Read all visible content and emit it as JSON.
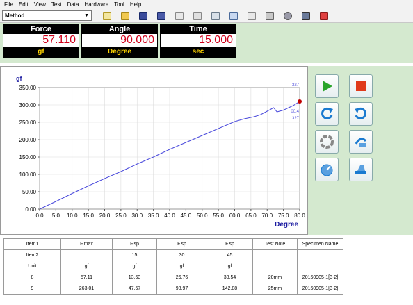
{
  "menu": [
    "File",
    "Edit",
    "View",
    "Test",
    "Data",
    "Hardware",
    "Tool",
    "Help"
  ],
  "toolbar": {
    "method_label": "Method",
    "icons": [
      "new-doc-icon",
      "open-folder-icon",
      "save-icon",
      "save-as-icon",
      "document-icon",
      "document-copy-icon",
      "settings-icon",
      "window-icon",
      "report-icon",
      "print-icon",
      "link-icon",
      "edit-icon",
      "exit-icon"
    ]
  },
  "readouts": [
    {
      "label": "Force",
      "value": "57.110",
      "unit": "gf"
    },
    {
      "label": "Angle",
      "value": "90.000",
      "unit": "Degree"
    },
    {
      "label": "Time",
      "value": "15.000",
      "unit": "sec"
    }
  ],
  "chart_data": {
    "type": "line",
    "ylabel": "gf",
    "xlabel": "Degree",
    "xlim": [
      0,
      80
    ],
    "ylim": [
      0,
      350
    ],
    "x_ticks": [
      "0.0",
      "5.0",
      "10.0",
      "15.0",
      "20.0",
      "25.0",
      "30.0",
      "35.0",
      "40.0",
      "45.0",
      "50.0",
      "55.0",
      "60.0",
      "65.0",
      "70.0",
      "75.0",
      "80.0"
    ],
    "y_ticks": [
      "0.00",
      "50.00",
      "100.00",
      "150.00",
      "200.00",
      "250.00",
      "300.00",
      "350.00"
    ],
    "series_color": "#4a4adc",
    "x": [
      0,
      5,
      10,
      15,
      20,
      25,
      30,
      35,
      40,
      45,
      50,
      55,
      60,
      63,
      66,
      68,
      70,
      72,
      73,
      75,
      78,
      80
    ],
    "y": [
      0,
      22,
      45,
      67,
      88,
      108,
      130,
      150,
      172,
      192,
      212,
      232,
      252,
      260,
      266,
      272,
      282,
      292,
      280,
      285,
      298,
      310
    ],
    "end_marker_labels": [
      "327",
      "00.4",
      "327"
    ],
    "end_marker_color": "#c00000"
  },
  "controls": [
    {
      "name": "start-icon",
      "color": "#2aa52a"
    },
    {
      "name": "stop-icon",
      "color": "#e03a1a"
    },
    {
      "name": "return-icon",
      "color": "#1a7ad0"
    },
    {
      "name": "undo-icon",
      "color": "#1a7ad0"
    },
    {
      "name": "reset-icon",
      "color": "#888888"
    },
    {
      "name": "calibrate-icon",
      "color": "#1a7ad0"
    },
    {
      "name": "speed-icon",
      "color": "#1a7ad0"
    },
    {
      "name": "fixture-icon",
      "color": "#1a7ad0"
    }
  ],
  "table": {
    "rows": [
      [
        "Item1",
        "F.max",
        "F.sp",
        "F.sp",
        "F.sp",
        "Test Note",
        "Specimen Name"
      ],
      [
        "Item2",
        "",
        "15",
        "30",
        "45",
        "",
        ""
      ],
      [
        "Unit",
        "gf",
        "gf",
        "gf",
        "gf",
        "",
        ""
      ],
      [
        "8",
        "57.11",
        "13.63",
        "26.76",
        "38.54",
        "20mm",
        "20160905-1[3-2]"
      ],
      [
        "9",
        "263.01",
        "47.57",
        "98.97",
        "142.88",
        "25mm",
        "20160905-1[3-2]"
      ]
    ]
  }
}
